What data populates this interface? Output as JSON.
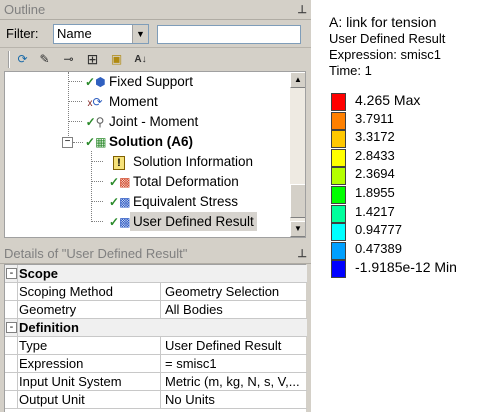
{
  "outline": {
    "title": "Outline",
    "pin_glyph": "⊥",
    "filter_label": "Filter:",
    "filter_value": "Name",
    "filter_text": "",
    "toolbar_icons": [
      "refresh-icon",
      "edit-icon",
      "node-link-icon",
      "expand-all-icon",
      "folder-icon",
      "sort-az-icon"
    ],
    "tree": [
      {
        "label": "Fixed Support",
        "icon": "fixed-support-icon",
        "status": "check"
      },
      {
        "label": "Moment",
        "icon": "moment-icon",
        "status": "none"
      },
      {
        "label": "Joint - Moment",
        "icon": "joint-moment-icon",
        "status": "check"
      },
      {
        "label": "Solution (A6)",
        "icon": "solution-icon",
        "status": "check",
        "bold": true,
        "expanded": true
      },
      {
        "label": "Solution Information",
        "icon": "solution-information-icon",
        "status": "none"
      },
      {
        "label": "Total Deformation",
        "icon": "deformation-icon",
        "status": "check"
      },
      {
        "label": "Equivalent Stress",
        "icon": "stress-icon",
        "status": "check"
      },
      {
        "label": "User Defined Result",
        "icon": "user-defined-result-icon",
        "status": "check",
        "selected": true
      }
    ]
  },
  "details": {
    "title": "Details of \"User Defined Result\"",
    "pin_glyph": "⊥",
    "rows": [
      {
        "type": "category",
        "label": "Scope",
        "toggle": "-"
      },
      {
        "key": "Scoping Method",
        "value": "Geometry Selection"
      },
      {
        "key": "Geometry",
        "value": "All Bodies"
      },
      {
        "type": "category",
        "label": "Definition",
        "toggle": "-"
      },
      {
        "key": "Type",
        "value": "User Defined Result"
      },
      {
        "key": "Expression",
        "value": "= smisc1"
      },
      {
        "key": "Input Unit System",
        "value": "Metric (m, kg, N, s, V,..."
      },
      {
        "key": "Output Unit",
        "value": "No Units"
      }
    ]
  },
  "legend": {
    "title": "A: link for tension",
    "subtitle": "User Defined Result",
    "expression": "Expression: smisc1",
    "time": "Time: 1",
    "bands": [
      {
        "value": "4.265 Max",
        "color": "#ff0000",
        "bold": true
      },
      {
        "value": "3.7911",
        "color": "#ff8000"
      },
      {
        "value": "3.3172",
        "color": "#ffc800"
      },
      {
        "value": "2.8433",
        "color": "#ffff00"
      },
      {
        "value": "2.3694",
        "color": "#b4ff00"
      },
      {
        "value": "1.8955",
        "color": "#00ff00"
      },
      {
        "value": "1.4217",
        "color": "#00ff9c"
      },
      {
        "value": "0.94777",
        "color": "#00ffff"
      },
      {
        "value": "0.47389",
        "color": "#00a0ff"
      },
      {
        "value": "-1.9185e-12 Min",
        "color": "#0000ff",
        "bold": true
      }
    ]
  }
}
